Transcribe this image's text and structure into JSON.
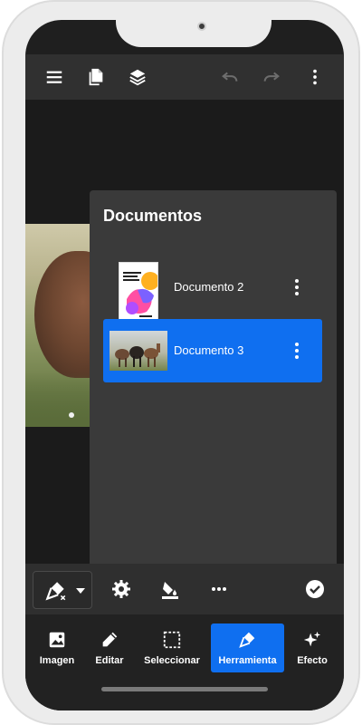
{
  "topbar": {
    "icons": [
      "menu-icon",
      "documents-icon",
      "layers-icon",
      "undo-icon",
      "redo-icon",
      "more-vertical-icon"
    ]
  },
  "documents_panel": {
    "title": "Documentos",
    "items": [
      {
        "name": "Documento 2",
        "thumb_text": "Patinaje Papá",
        "active": false
      },
      {
        "name": "Documento 3",
        "active": true
      }
    ]
  },
  "toolbar": {
    "icons": [
      "pen-tool-icon",
      "chevron-down-icon",
      "settings-icon",
      "fill-icon",
      "more-horizontal-icon",
      "check-circle-icon"
    ]
  },
  "bottom_nav": {
    "items": [
      {
        "label": "Imagen",
        "icon": "image-icon",
        "active": false
      },
      {
        "label": "Editar",
        "icon": "pencil-icon",
        "active": false
      },
      {
        "label": "Seleccionar",
        "icon": "selection-icon",
        "active": false
      },
      {
        "label": "Herramienta",
        "icon": "pen-tool-icon",
        "active": true
      },
      {
        "label": "Efecto",
        "icon": "sparkles-icon",
        "active": false
      }
    ]
  },
  "colors": {
    "accent": "#0f6ff0",
    "panel": "#3a3a3a",
    "topbar": "#303030",
    "nav": "#222222"
  }
}
